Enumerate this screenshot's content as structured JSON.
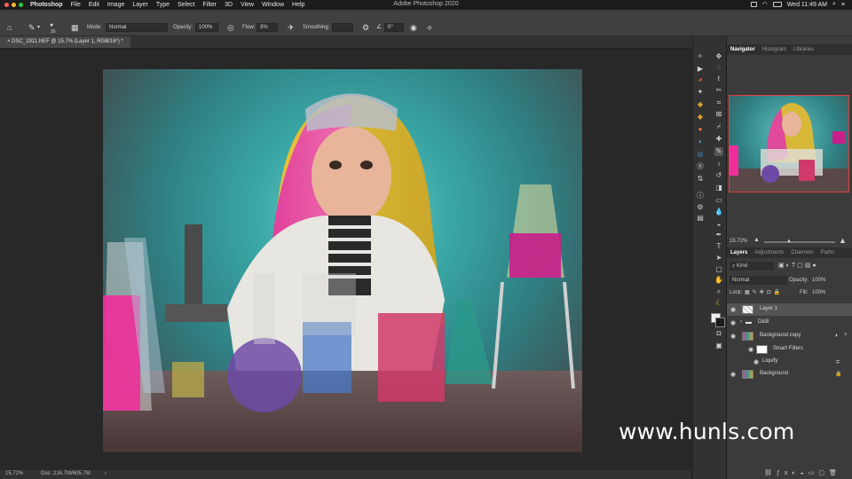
{
  "menubar": {
    "apple": "",
    "items": [
      "Photoshop",
      "File",
      "Edit",
      "Image",
      "Layer",
      "Type",
      "Select",
      "Filter",
      "3D",
      "View",
      "Window",
      "Help"
    ],
    "title": "Adobe Photoshop 2020",
    "clock": "Wed 11:49 AM"
  },
  "options": {
    "brush_size": "26",
    "mode_label": "Mode:",
    "mode_value": "Normal",
    "opacity_label": "Opacity:",
    "opacity_value": "100%",
    "flow_label": "Flow:",
    "flow_value": "3%",
    "smoothing_label": "Smoothing:",
    "angle_value": "0°"
  },
  "document": {
    "tab_title": "DSC_1911.NEF @ 15.7% (Layer 1, RGB/16*) *"
  },
  "statusbar": {
    "zoom": "15.72%",
    "doc_info": "Doc: 216.7M/605.7M"
  },
  "panels": {
    "top_tabs": [
      "Navigator",
      "Histogram",
      "Libraries"
    ],
    "nav_zoom": "15.72%",
    "layer_tabs": [
      "Layers",
      "Adjustments",
      "Channels",
      "Paths"
    ],
    "kind_label": "Kind",
    "blend_mode": "Normal",
    "opacity_label": "Opacity:",
    "opacity_value": "100%",
    "lock_label": "Lock:",
    "fill_label": "Fill:",
    "fill_value": "100%",
    "layers": [
      {
        "name": "Layer 1"
      },
      {
        "name": "D&B"
      },
      {
        "name": "Background copy"
      },
      {
        "name": "Smart Filters"
      },
      {
        "name": "Liquify"
      },
      {
        "name": "Background"
      }
    ]
  },
  "watermark": "www.hunls.com"
}
